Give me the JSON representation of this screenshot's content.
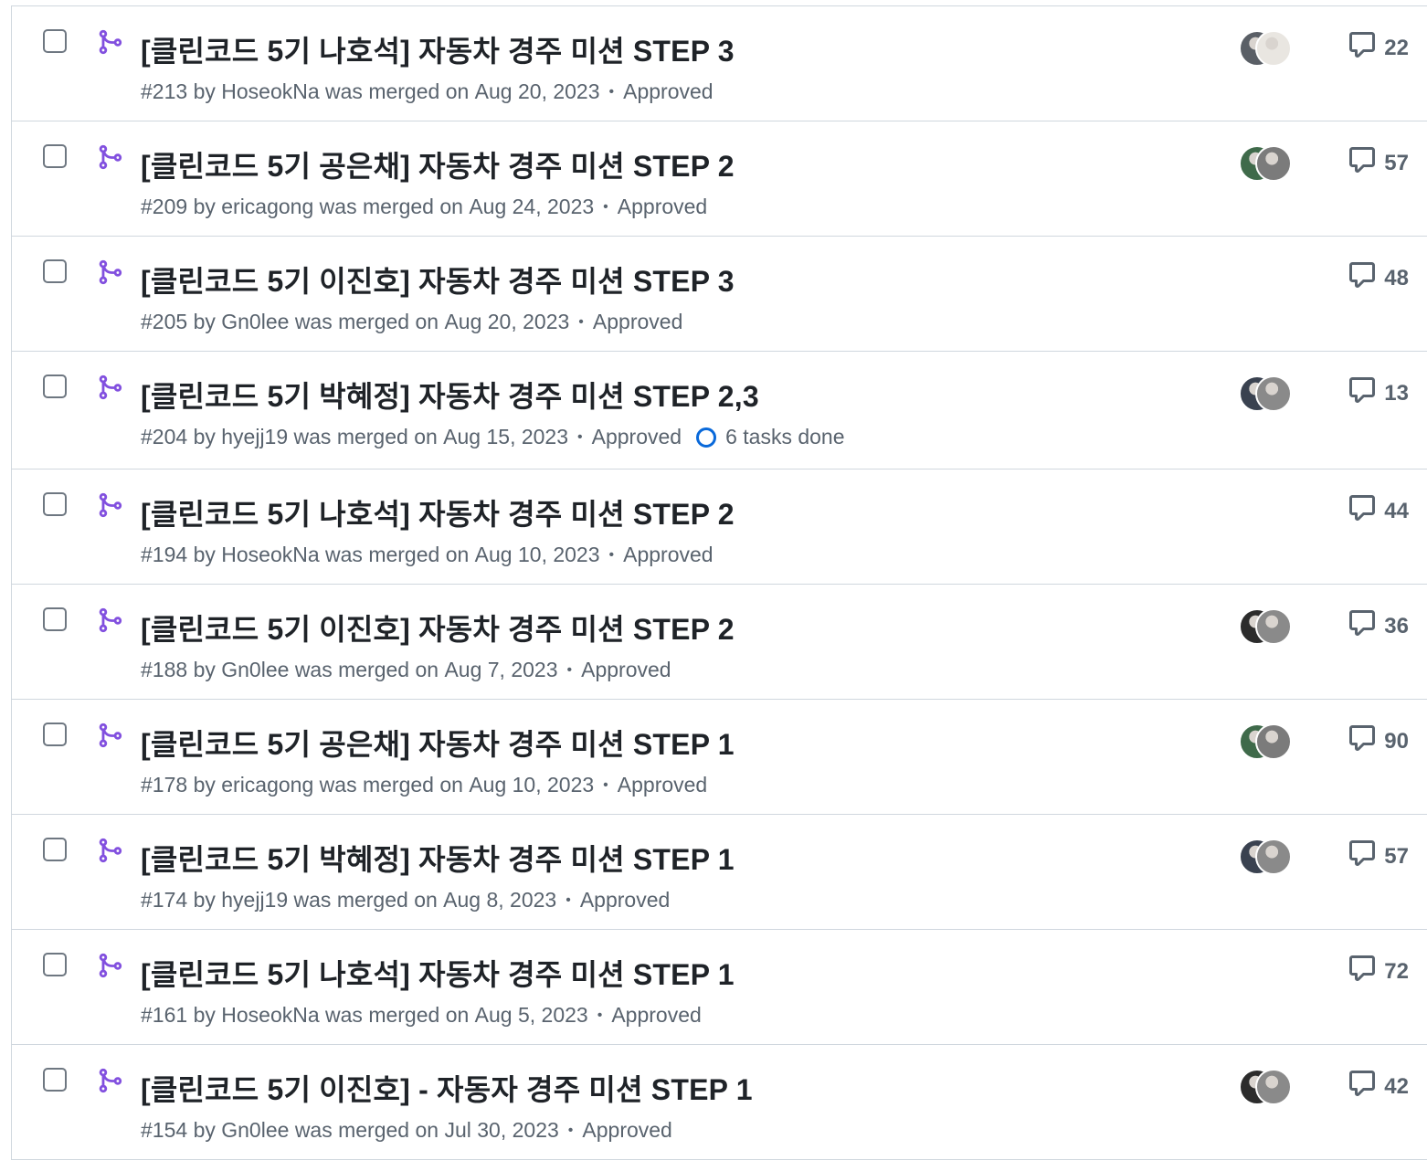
{
  "pull_requests": [
    {
      "title": "[클린코드 5기 나호석] 자동차 경주 미션 STEP 3",
      "number": "#213",
      "author": "HoseokNa",
      "merged_on": "Aug 20, 2023",
      "review": "Approved",
      "tasks": "",
      "comments": "22",
      "has_avatars": true,
      "avatar_colors": [
        "#5a5f66",
        "#e9e6e1"
      ]
    },
    {
      "title": "[클린코드 5기 공은채] 자동차 경주 미션 STEP 2",
      "number": "#209",
      "author": "ericagong",
      "merged_on": "Aug 24, 2023",
      "review": "Approved",
      "tasks": "",
      "comments": "57",
      "has_avatars": true,
      "avatar_colors": [
        "#3f6a4a",
        "#7b7b7b"
      ]
    },
    {
      "title": "[클린코드 5기 이진호] 자동차 경주 미션 STEP 3",
      "number": "#205",
      "author": "Gn0lee",
      "merged_on": "Aug 20, 2023",
      "review": "Approved",
      "tasks": "",
      "comments": "48",
      "has_avatars": false,
      "avatar_colors": []
    },
    {
      "title": "[클린코드 5기 박혜정] 자동차 경주 미션 STEP 2,3",
      "number": "#204",
      "author": "hyejj19",
      "merged_on": "Aug 15, 2023",
      "review": "Approved",
      "tasks": "6 tasks done",
      "comments": "13",
      "has_avatars": true,
      "avatar_colors": [
        "#3a4250",
        "#8a8a8a"
      ]
    },
    {
      "title": "[클린코드 5기 나호석] 자동차 경주 미션 STEP 2",
      "number": "#194",
      "author": "HoseokNa",
      "merged_on": "Aug 10, 2023",
      "review": "Approved",
      "tasks": "",
      "comments": "44",
      "has_avatars": false,
      "avatar_colors": []
    },
    {
      "title": "[클린코드 5기 이진호] 자동차 경주 미션 STEP 2",
      "number": "#188",
      "author": "Gn0lee",
      "merged_on": "Aug 7, 2023",
      "review": "Approved",
      "tasks": "",
      "comments": "36",
      "has_avatars": true,
      "avatar_colors": [
        "#2c2c2c",
        "#8a8a8a"
      ]
    },
    {
      "title": "[클린코드 5기 공은채] 자동차 경주 미션 STEP 1",
      "number": "#178",
      "author": "ericagong",
      "merged_on": "Aug 10, 2023",
      "review": "Approved",
      "tasks": "",
      "comments": "90",
      "has_avatars": true,
      "avatar_colors": [
        "#3f6a4a",
        "#7b7b7b"
      ]
    },
    {
      "title": "[클린코드 5기 박혜정] 자동차 경주 미션 STEP 1",
      "number": "#174",
      "author": "hyejj19",
      "merged_on": "Aug 8, 2023",
      "review": "Approved",
      "tasks": "",
      "comments": "57",
      "has_avatars": true,
      "avatar_colors": [
        "#3a4250",
        "#8a8a8a"
      ]
    },
    {
      "title": "[클린코드 5기 나호석] 자동차 경주 미션 STEP 1",
      "number": "#161",
      "author": "HoseokNa",
      "merged_on": "Aug 5, 2023",
      "review": "Approved",
      "tasks": "",
      "comments": "72",
      "has_avatars": false,
      "avatar_colors": []
    },
    {
      "title": "[클린코드 5기 이진호] - 자동자 경주 미션 STEP 1",
      "number": "#154",
      "author": "Gn0lee",
      "merged_on": "Jul 30, 2023",
      "review": "Approved",
      "tasks": "",
      "comments": "42",
      "has_avatars": true,
      "avatar_colors": [
        "#2c2c2c",
        "#8a8a8a"
      ]
    }
  ],
  "labels": {
    "by": "by",
    "was_merged_on": "was merged on",
    "separator": "•"
  },
  "colors": {
    "merged_icon": "#8250df",
    "task_ring": "#0969da",
    "border": "#d0d7de",
    "muted_text": "#59636e"
  },
  "icons": {
    "merged": "git-merge-icon",
    "comment": "comment-icon",
    "checkbox": "checkbox-icon",
    "tasks": "tasks-progress-icon"
  }
}
